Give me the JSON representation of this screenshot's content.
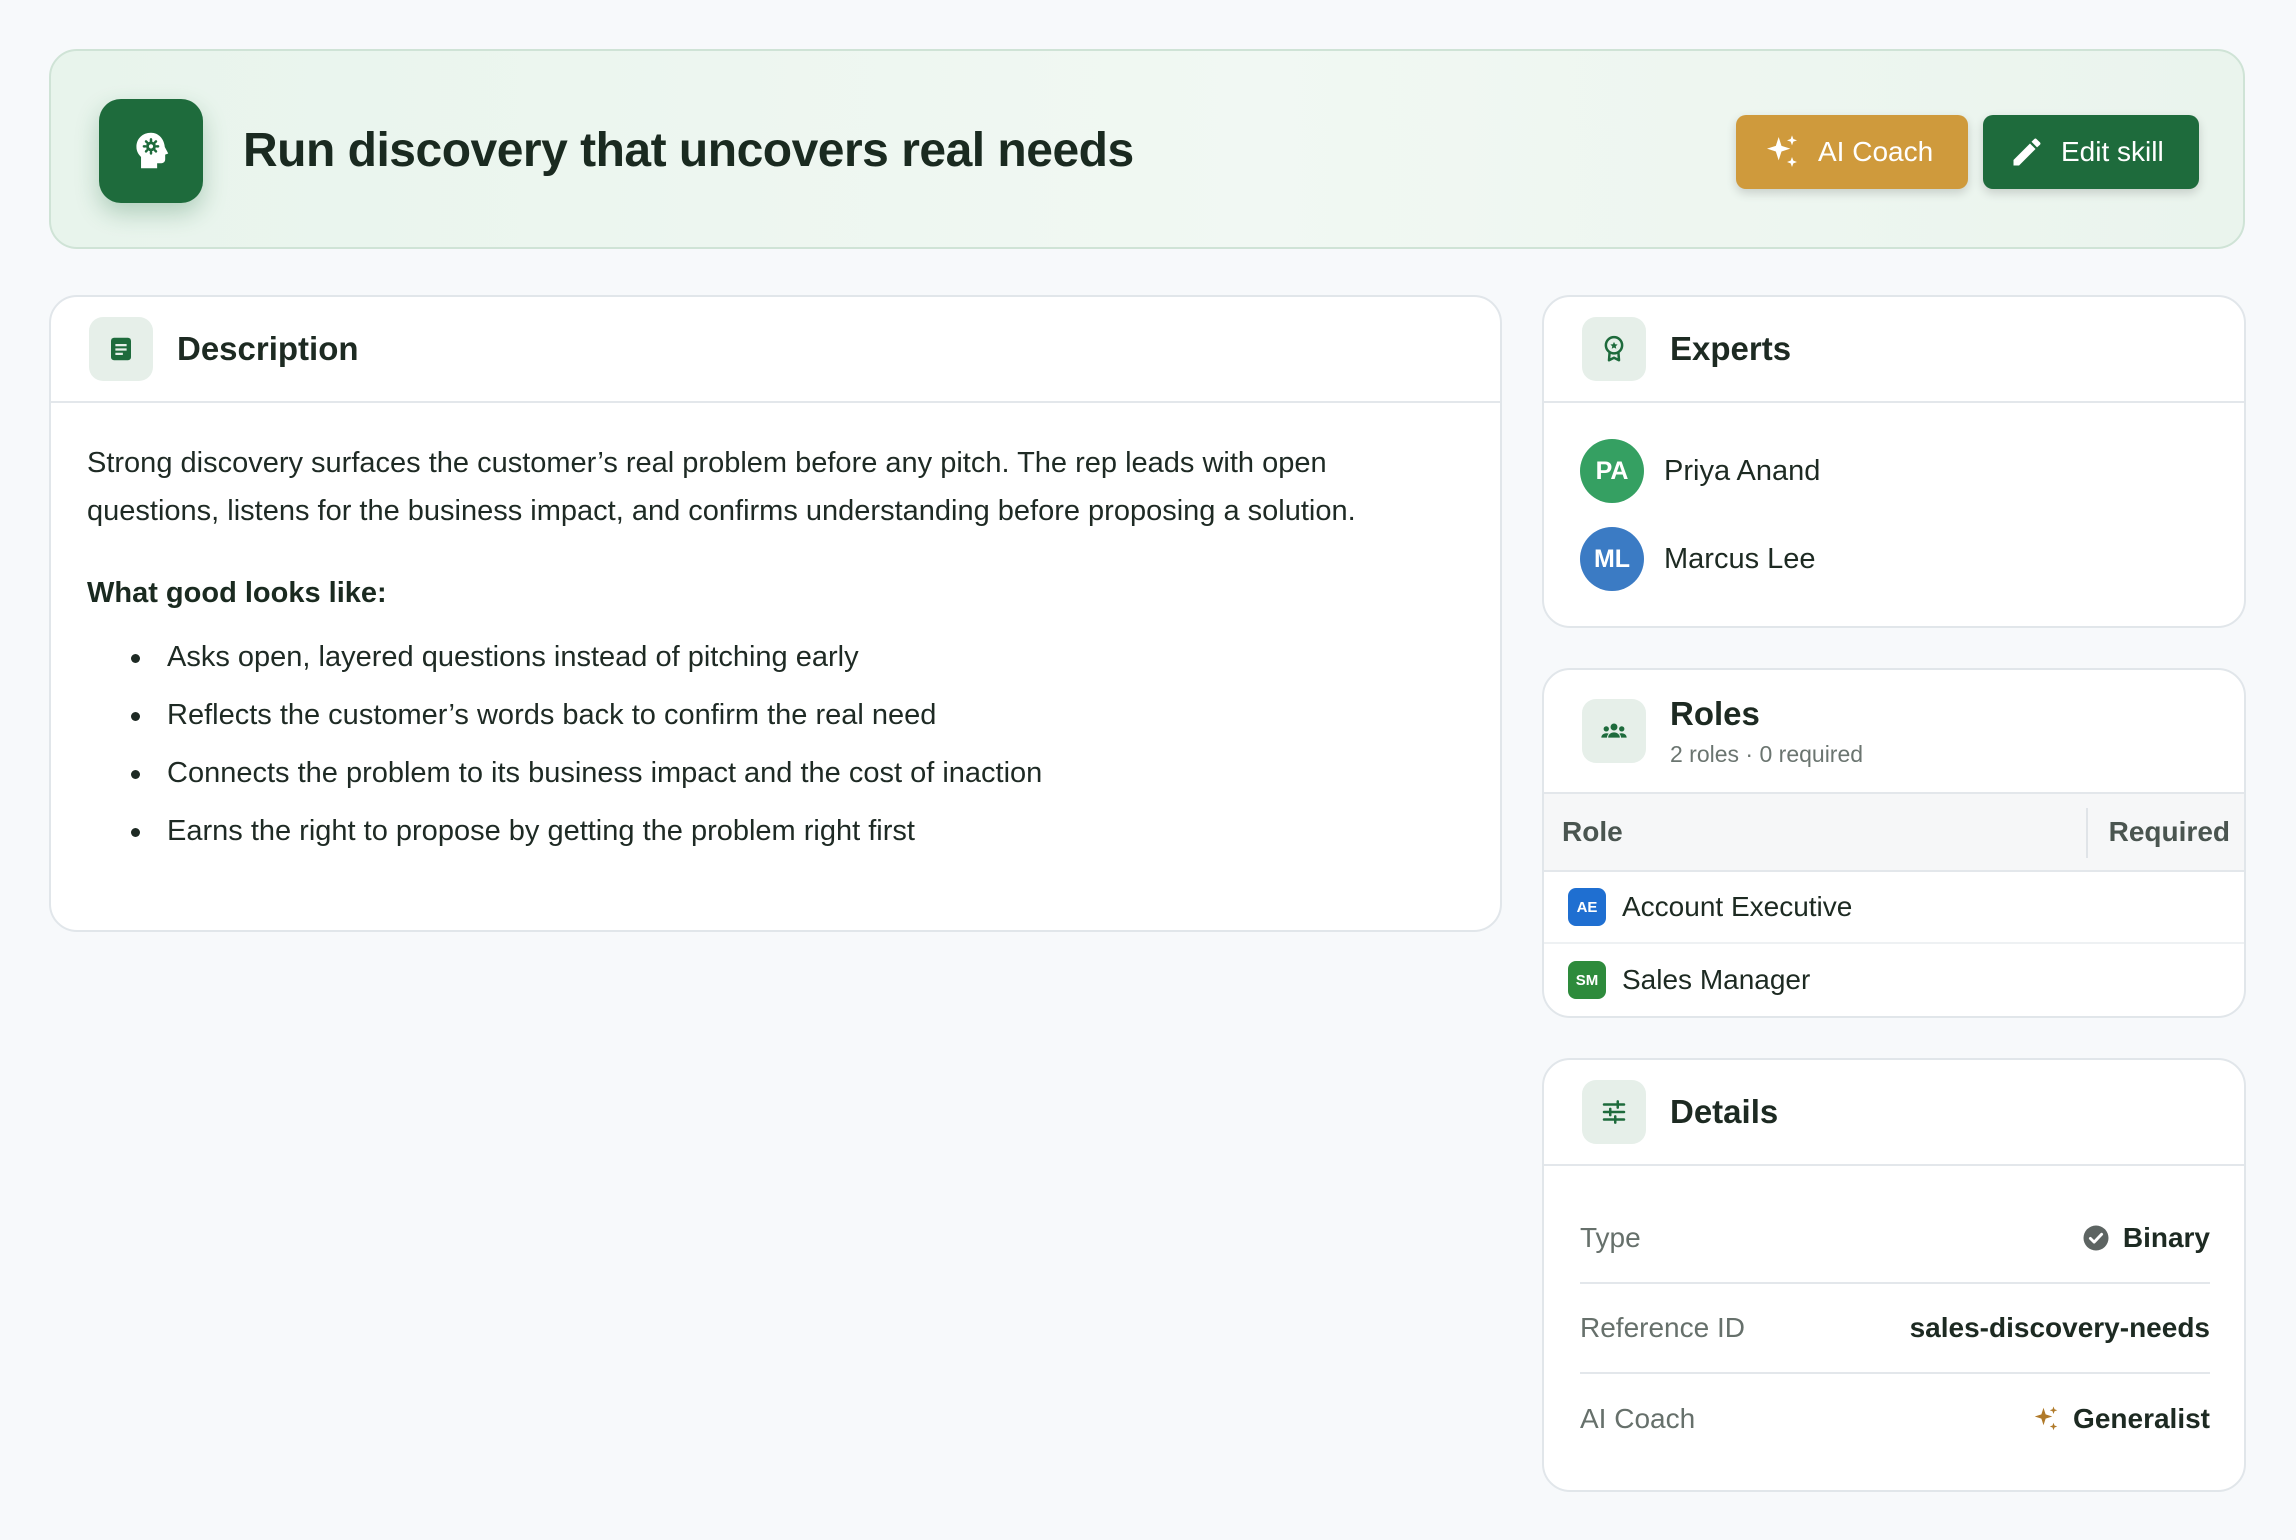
{
  "header": {
    "title": "Run discovery that uncovers real needs",
    "ai_coach_label": "AI Coach",
    "edit_label": "Edit skill"
  },
  "description": {
    "title": "Description",
    "paragraph": "Strong discovery surfaces the customer’s real problem before any pitch. The rep leads with open questions, listens for the business impact, and confirms understanding before proposing a solution.",
    "subheading": "What good looks like:",
    "bullets": [
      "Asks open, layered questions instead of pitching early",
      "Reflects the customer’s words back to confirm the real need",
      "Connects the problem to its business impact and the cost of inaction",
      "Earns the right to propose by getting the problem right first"
    ]
  },
  "experts": {
    "title": "Experts",
    "people": [
      {
        "initials": "PA",
        "name": "Priya Anand",
        "color": "#35a062"
      },
      {
        "initials": "ML",
        "name": "Marcus Lee",
        "color": "#3b7bc4"
      }
    ]
  },
  "roles": {
    "title": "Roles",
    "subtitle": "2 roles · 0 required",
    "col_role": "Role",
    "col_required": "Required",
    "rows": [
      {
        "badge": "AE",
        "name": "Account Executive",
        "color": "#1f6fd1"
      },
      {
        "badge": "SM",
        "name": "Sales Manager",
        "color": "#2e8b3c"
      }
    ]
  },
  "details": {
    "title": "Details",
    "type_label": "Type",
    "type_value": "Binary",
    "ref_label": "Reference ID",
    "ref_value": "sales-discovery-needs",
    "coach_label": "AI Coach",
    "coach_value": "Generalist"
  },
  "colors": {
    "brand_green": "#1e6b3c",
    "coach_gold": "#cf9a3c",
    "sparkle_gold": "#b07a2a"
  }
}
